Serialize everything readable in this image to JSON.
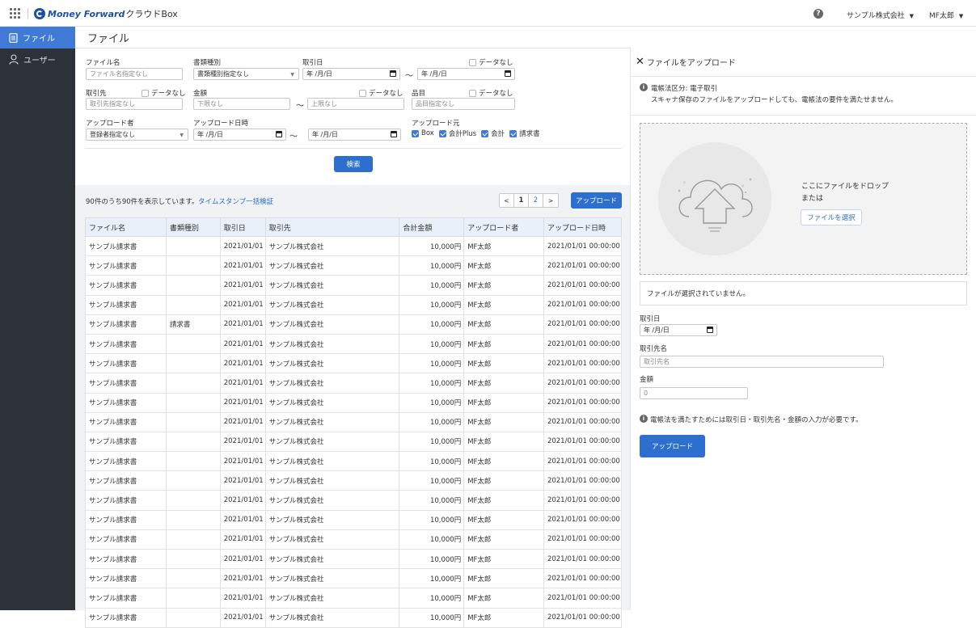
{
  "header": {
    "logo_text": "Money Forward",
    "product": "クラウドBox",
    "company": "サンプル株式会社",
    "user": "MF太郎"
  },
  "sidebar": {
    "items": [
      {
        "label": "ファイル"
      },
      {
        "label": "ユーザー"
      }
    ]
  },
  "page_title": "ファイル",
  "filters": {
    "file_name_label": "ファイル名",
    "file_name_placeholder": "ファイル名指定なし",
    "doc_type_label": "書類種別",
    "doc_type_value": "書類種別指定なし",
    "date_label": "取引日",
    "date_placeholder": "年 /月/日",
    "no_data": "データなし",
    "partner_label": "取引先",
    "partner_placeholder": "取引先指定なし",
    "amount_label": "金額",
    "amount_min_placeholder": "下限なし",
    "amount_max_placeholder": "上限なし",
    "item_label": "品目",
    "item_placeholder": "品目指定なし",
    "uploader_label": "アップロード者",
    "uploader_value": "登録者指定なし",
    "upload_date_label": "アップロード日時",
    "source_label": "アップロード元",
    "sources": [
      "Box",
      "会計Plus",
      "会計",
      "請求書"
    ],
    "tilde": "〜",
    "search_button": "検索"
  },
  "results": {
    "summary": "90件のうち90件を表示しています。",
    "timestamp_link": "タイムスタンプ一括検証",
    "pagination": {
      "prev": "<",
      "pages": [
        "1",
        "2"
      ],
      "next": ">"
    },
    "upload_button": "アップロード"
  },
  "table": {
    "headers": [
      "ファイル名",
      "書類種別",
      "取引日",
      "取引先",
      "合計金額",
      "アップロード者",
      "アップロード日時"
    ],
    "rows": [
      [
        "サンプル請求書",
        "",
        "2021/01/01",
        "サンプル株式会社",
        "10,000円",
        "MF太郎",
        "2021/01/01 00:00:00"
      ],
      [
        "サンプル請求書",
        "",
        "2021/01/01",
        "サンプル株式会社",
        "10,000円",
        "MF太郎",
        "2021/01/01 00:00:00"
      ],
      [
        "サンプル請求書",
        "",
        "2021/01/01",
        "サンプル株式会社",
        "10,000円",
        "MF太郎",
        "2021/01/01 00:00:00"
      ],
      [
        "サンプル請求書",
        "",
        "2021/01/01",
        "サンプル株式会社",
        "10,000円",
        "MF太郎",
        "2021/01/01 00:00:00"
      ],
      [
        "サンプル請求書",
        "請求書",
        "2021/01/01",
        "サンプル株式会社",
        "10,000円",
        "MF太郎",
        "2021/01/01 00:00:00"
      ],
      [
        "サンプル請求書",
        "",
        "2021/01/01",
        "サンプル株式会社",
        "10,000円",
        "MF太郎",
        "2021/01/01 00:00:00"
      ],
      [
        "サンプル請求書",
        "",
        "2021/01/01",
        "サンプル株式会社",
        "10,000円",
        "MF太郎",
        "2021/01/01 00:00:00"
      ],
      [
        "サンプル請求書",
        "",
        "2021/01/01",
        "サンプル株式会社",
        "10,000円",
        "MF太郎",
        "2021/01/01 00:00:00"
      ],
      [
        "サンプル請求書",
        "",
        "2021/01/01",
        "サンプル株式会社",
        "10,000円",
        "MF太郎",
        "2021/01/01 00:00:00"
      ],
      [
        "サンプル請求書",
        "",
        "2021/01/01",
        "サンプル株式会社",
        "10,000円",
        "MF太郎",
        "2021/01/01 00:00:00"
      ],
      [
        "サンプル請求書",
        "",
        "2021/01/01",
        "サンプル株式会社",
        "10,000円",
        "MF太郎",
        "2021/01/01 00:00:00"
      ],
      [
        "サンプル請求書",
        "",
        "2021/01/01",
        "サンプル株式会社",
        "10,000円",
        "MF太郎",
        "2021/01/01 00:00:00"
      ],
      [
        "サンプル請求書",
        "",
        "2021/01/01",
        "サンプル株式会社",
        "10,000円",
        "MF太郎",
        "2021/01/01 00:00:00"
      ],
      [
        "サンプル請求書",
        "",
        "2021/01/01",
        "サンプル株式会社",
        "10,000円",
        "MF太郎",
        "2021/01/01 00:00:00"
      ],
      [
        "サンプル請求書",
        "",
        "2021/01/01",
        "サンプル株式会社",
        "10,000円",
        "MF太郎",
        "2021/01/01 00:00:00"
      ],
      [
        "サンプル請求書",
        "",
        "2021/01/01",
        "サンプル株式会社",
        "10,000円",
        "MF太郎",
        "2021/01/01 00:00:00"
      ],
      [
        "サンプル請求書",
        "",
        "2021/01/01",
        "サンプル株式会社",
        "10,000円",
        "MF太郎",
        "2021/01/01 00:00:00"
      ],
      [
        "サンプル請求書",
        "",
        "2021/01/01",
        "サンプル株式会社",
        "10,000円",
        "MF太郎",
        "2021/01/01 00:00:00"
      ],
      [
        "サンプル請求書",
        "",
        "2021/01/01",
        "サンプル株式会社",
        "10,000円",
        "MF太郎",
        "2021/01/01 00:00:00"
      ],
      [
        "サンプル請求書",
        "",
        "2021/01/01",
        "サンプル株式会社",
        "10,000円",
        "MF太郎",
        "2021/01/01 00:00:00"
      ]
    ]
  },
  "upload_panel": {
    "title": "ファイルをアップロード",
    "notice_title": "電帳法区分: 電子取引",
    "notice_body": "スキャナ保存のファイルをアップロードしても、電帳法の要件を満たせません。",
    "drop_text": "ここにファイルをドロップ",
    "or_text": "または",
    "select_button": "ファイルを選択",
    "no_file": "ファイルが選択されていません。",
    "date_label": "取引日",
    "date_placeholder": "年 /月/日",
    "partner_label": "取引先名",
    "partner_placeholder": "取引先名",
    "amount_label": "金額",
    "amount_value": "0",
    "requirement": "電帳法を満たすためには取引日・取引先名・金額の入力が必要です。",
    "upload_button": "アップロード"
  },
  "colors": {
    "accent": "#2c6fcf",
    "sidebar": "#2c3238",
    "sidebar_active": "#3e7ad6",
    "table_header": "#eaf0fa"
  }
}
